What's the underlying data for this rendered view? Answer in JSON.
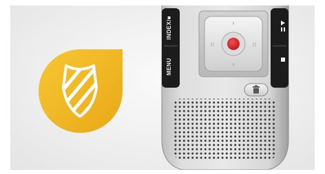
{
  "badge": {
    "icon": "shield-striped-icon",
    "color": "#f2b824"
  },
  "device": {
    "left_buttons": {
      "index_label": "INDEX/■",
      "menu_label": "MENU"
    },
    "right_buttons": {
      "icon": "play-pause-icon"
    },
    "record_button": {
      "icon": "record-dot-icon",
      "color": "#d7262b"
    },
    "delete_button": {
      "icon": "trash-icon"
    },
    "speaker": {
      "icon": "speaker-grille"
    }
  }
}
